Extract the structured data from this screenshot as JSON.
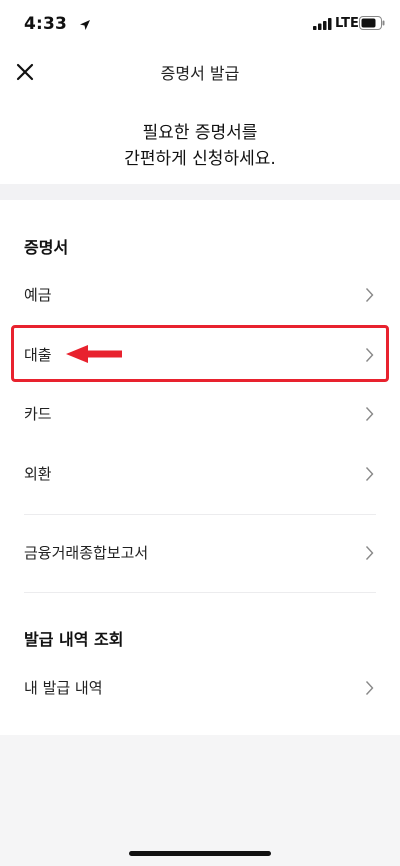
{
  "status_bar": {
    "time": "4:33",
    "network": "LTE"
  },
  "header": {
    "title": "증명서 발급"
  },
  "intro": {
    "line1": "필요한 증명서를",
    "line2": "간편하게 신청하세요."
  },
  "certificates": {
    "heading": "증명서",
    "items": [
      {
        "label": "예금"
      },
      {
        "label": "대출"
      },
      {
        "label": "카드"
      },
      {
        "label": "외환"
      },
      {
        "label": "금융거래종합보고서"
      }
    ]
  },
  "history": {
    "heading": "발급 내역 조회",
    "items": [
      {
        "label": "내 발급 내역"
      }
    ]
  },
  "colors": {
    "highlight": "#e8222e",
    "background": "#f5f5f6"
  },
  "icons": [
    "close-icon",
    "chevron-right-icon",
    "location-arrow-icon",
    "signal-icon",
    "battery-icon"
  ]
}
